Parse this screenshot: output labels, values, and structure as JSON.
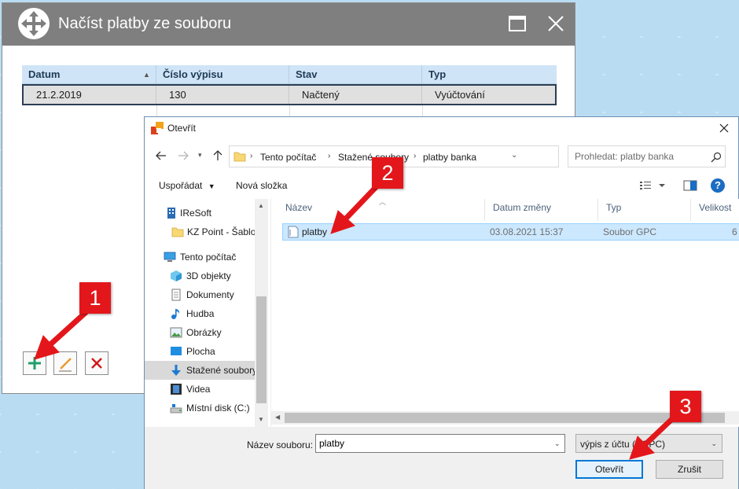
{
  "main_window": {
    "title": "Načíst platby ze souboru",
    "grid": {
      "columns": [
        "Datum",
        "Číslo výpisu",
        "Stav",
        "Typ"
      ],
      "rows": [
        {
          "datum": "21.2.2019",
          "cislo": "130",
          "stav": "Načtený",
          "typ": "Vyúčtování"
        }
      ]
    },
    "toolbar": [
      "add-icon",
      "edit-icon",
      "delete-icon"
    ]
  },
  "open_dialog": {
    "title": "Otevřít",
    "breadcrumbs": [
      "Tento počítač",
      "Stažené soubory",
      "platby banka"
    ],
    "search_placeholder": "Prohledat: platby banka",
    "organize_label": "Uspořádat",
    "new_folder_label": "Nová složka",
    "help_label": "?",
    "nav_tree": [
      {
        "label": "IReSoft",
        "icon": "building-icon"
      },
      {
        "label": "KZ Point - Šablo",
        "icon": "folder-icon"
      },
      {
        "label": "Tento počítač",
        "icon": "computer-icon"
      },
      {
        "label": "3D objekty",
        "icon": "cube-icon"
      },
      {
        "label": "Dokumenty",
        "icon": "document-icon"
      },
      {
        "label": "Hudba",
        "icon": "music-icon"
      },
      {
        "label": "Obrázky",
        "icon": "pictures-icon"
      },
      {
        "label": "Plocha",
        "icon": "desktop-icon"
      },
      {
        "label": "Stažené soubory",
        "icon": "download-icon"
      },
      {
        "label": "Videa",
        "icon": "video-icon"
      },
      {
        "label": "Místní disk (C:)",
        "icon": "disk-icon"
      }
    ],
    "list_columns": [
      "Název",
      "Datum změny",
      "Typ",
      "Velikost"
    ],
    "files": [
      {
        "name": "platby",
        "modified": "03.08.2021 15:37",
        "type": "Soubor GPC",
        "size": "6"
      }
    ],
    "filename_label": "Název souboru:",
    "filename_value": "platby",
    "filetype_value": "výpis z účtu (*.GPC)",
    "open_label": "Otevřít",
    "cancel_label": "Zrušit"
  },
  "annotations": [
    "1",
    "2",
    "3"
  ],
  "colors": {
    "accent": "#0078d7",
    "badge": "#e3171b",
    "selection": "#cce8ff",
    "titlebar": "#7f7f7f"
  }
}
